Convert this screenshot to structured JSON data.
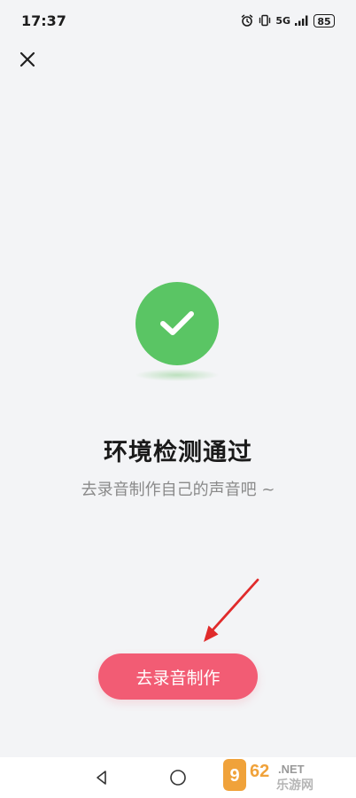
{
  "status_bar": {
    "time": "17:37",
    "network_label": "5G",
    "battery_level": "85",
    "icons": [
      "alarm-icon",
      "vibrate-icon",
      "signal-icon",
      "battery-icon"
    ]
  },
  "header": {
    "close_icon": "close-icon"
  },
  "main": {
    "status_icon": "check-circle-icon",
    "title": "环境检测通过",
    "subtitle": "去录音制作自己的声音吧 ~",
    "primary_button_label": "去录音制作"
  },
  "annotation": {
    "arrow_color": "#e02b2b"
  },
  "nav_bar": {
    "buttons": [
      "back-icon",
      "home-icon"
    ]
  },
  "watermark": {
    "text": "962.NET 乐游网"
  },
  "colors": {
    "background": "#f3f4f6",
    "success": "#5ac564",
    "accent": "#f25c74",
    "title": "#1a1a1a",
    "subtitle": "#8a8a8a"
  }
}
